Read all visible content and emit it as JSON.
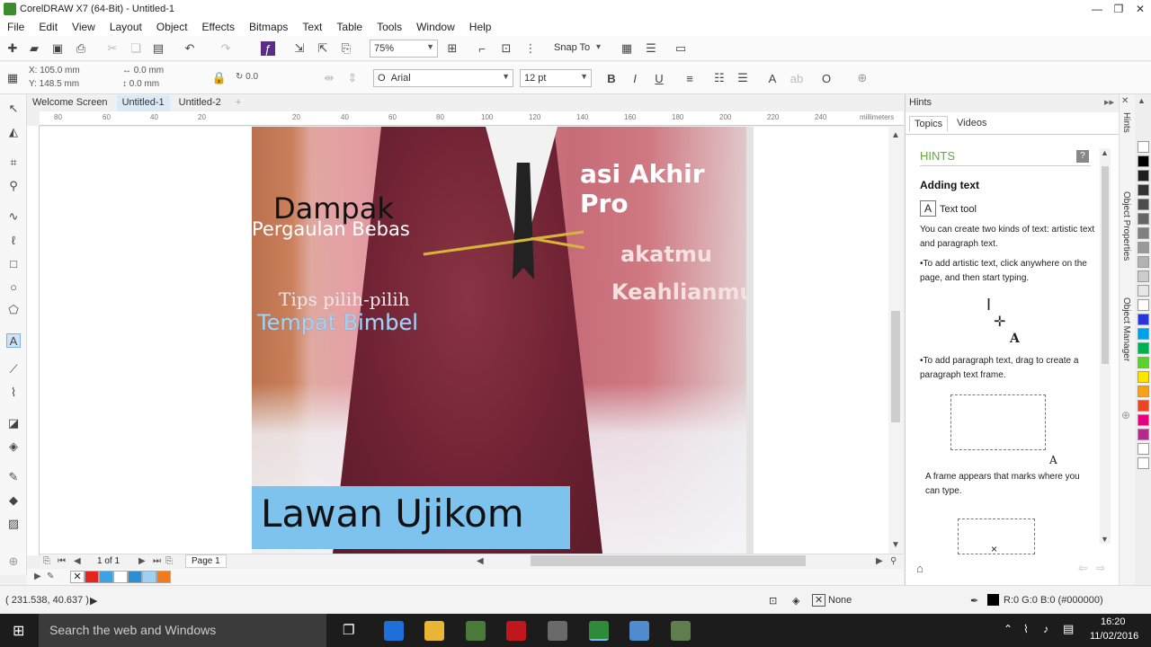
{
  "window": {
    "title": "CorelDRAW X7 (64-Bit) - Untitled-1",
    "controls": [
      "—",
      "❐",
      "✕"
    ]
  },
  "menu": [
    "File",
    "Edit",
    "View",
    "Layout",
    "Object",
    "Effects",
    "Bitmaps",
    "Text",
    "Table",
    "Tools",
    "Window",
    "Help"
  ],
  "toolbar1": {
    "zoom": "75%",
    "snap_to": "Snap To"
  },
  "toolbar2": {
    "x": "X: 105.0 mm",
    "y": "Y: 148.5 mm",
    "w": "0.0 mm",
    "h": "0.0 mm",
    "angle": "0.0",
    "font": "Arial",
    "size": "12 pt"
  },
  "doc_tabs": [
    "Welcome Screen",
    "Untitled-1",
    "Untitled-2"
  ],
  "ruler_labels": [
    "80",
    "60",
    "40",
    "20",
    "20",
    "40",
    "60",
    "80",
    "100",
    "120",
    "140",
    "160",
    "180",
    "200",
    "220",
    "240"
  ],
  "ruler_unit": "millimeters",
  "canvas_text": {
    "dampak": "Dampak",
    "pergaulan": "Pergaulan Bebas",
    "tips": "Tips pilih-pilih",
    "tempat": "Tempat Bimbel",
    "lawan": "Lawan Ujikom",
    "bg_line1": "asi Akhir Pro",
    "bg_line2": "akatmu",
    "bg_line3": "Keahlianmu"
  },
  "page_nav": {
    "count": "1 of 1",
    "page": "Page 1"
  },
  "status": {
    "coords": "( 231.538, 40.637 )",
    "fill": "None",
    "outline": "R:0 G:0 B:0 (#000000)"
  },
  "hints": {
    "panel_title": "Hints",
    "tab_topics": "Topics",
    "tab_videos": "Videos",
    "heading": "HINTS",
    "subheading": "Adding text",
    "tool": "Text tool",
    "p1": "You can create two kinds of text: artistic text and paragraph text.",
    "b1": "•To add artistic text, click anywhere on the page, and then start typing.",
    "b2": "•To add paragraph text, drag to create a paragraph text frame.",
    "p2": "A frame appears that marks where you can type."
  },
  "side_tabs": [
    "Hints",
    "Object Properties",
    "Object Manager"
  ],
  "palette_colors": [
    "#e52421",
    "#3aa3e3",
    "#ffffff",
    "#2b8fd1",
    "#9fd0f2",
    "#f07b1b"
  ],
  "right_palette": [
    "#ffffff",
    "#000000",
    "#1e1e1e",
    "#333333",
    "#4d4d4d",
    "#666666",
    "#808080",
    "#999999",
    "#b3b3b3",
    "#cccccc",
    "#e6e6e6",
    "#ffffff",
    "#2a35d8",
    "#00a0e9",
    "#00b050",
    "#5ecf2d",
    "#ffe600",
    "#f7a21b",
    "#ec4524",
    "#e5007e",
    "#b02b8c",
    "#ffffff",
    "#ffffff"
  ],
  "taskbar": {
    "search": "Search the web and Windows",
    "time": "16:20",
    "date": "11/02/2016"
  }
}
